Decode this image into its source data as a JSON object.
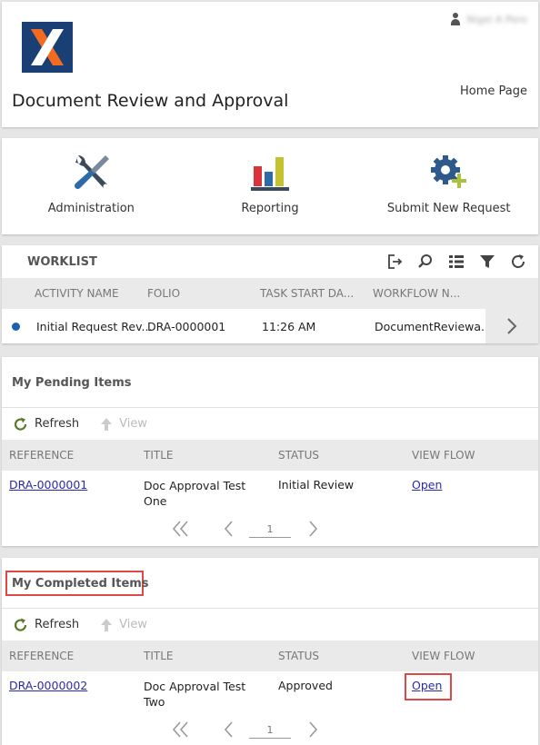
{
  "header": {
    "user_name": "Nigel A Pero",
    "app_title": "Document Review and Approval",
    "home_link": "Home Page"
  },
  "apps": [
    {
      "label": "Administration",
      "icon": "tools-icon"
    },
    {
      "label": "Reporting",
      "icon": "bar-chart-icon"
    },
    {
      "label": "Submit New Request",
      "icon": "gear-add-icon"
    }
  ],
  "worklist": {
    "title": "WORKLIST",
    "columns": [
      "ACTIVITY NAME",
      "FOLIO",
      "TASK START DA...",
      "WORKFLOW N..."
    ],
    "rows": [
      {
        "activity": "Initial Request Rev...",
        "folio": "DRA-0000001",
        "start": "11:26 AM",
        "workflow": "DocumentReviewa..."
      }
    ]
  },
  "pending": {
    "title": "My Pending Items",
    "refresh_label": "Refresh",
    "view_label": "View",
    "columns": [
      "REFERENCE",
      "TITLE",
      "STATUS",
      "VIEW FLOW"
    ],
    "rows": [
      {
        "reference": "DRA-0000001",
        "title": "Doc Approval Test One",
        "status": "Initial Review",
        "view_flow": "Open"
      }
    ],
    "page": "1"
  },
  "completed": {
    "title": "My Completed Items",
    "refresh_label": "Refresh",
    "view_label": "View",
    "columns": [
      "REFERENCE",
      "TITLE",
      "STATUS",
      "VIEW FLOW"
    ],
    "rows": [
      {
        "reference": "DRA-0000002",
        "title": "Doc Approval Test Two",
        "status": "Approved",
        "view_flow": "Open"
      }
    ],
    "page": "1"
  },
  "colors": {
    "logo_bg": "#1a3f74",
    "logo_orange": "#f26b21",
    "highlight": "#e04848",
    "link": "#2a2aa8",
    "status_dot": "#1e5fb3"
  }
}
